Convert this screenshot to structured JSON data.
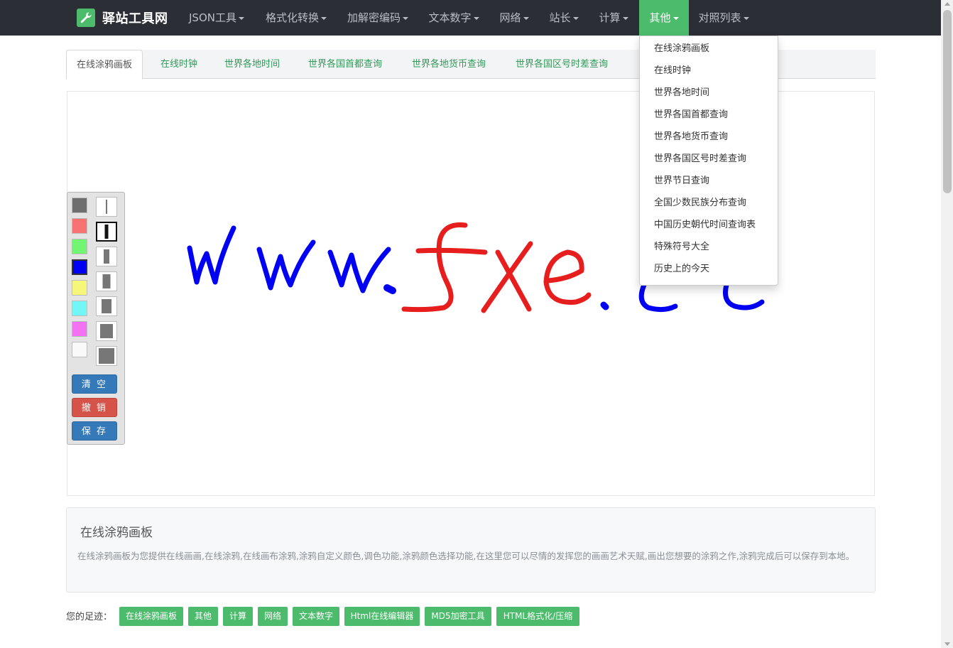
{
  "navbar": {
    "brand": "驿站工具网",
    "items": [
      {
        "label": "JSON工具"
      },
      {
        "label": "格式化转换"
      },
      {
        "label": "加解密编码"
      },
      {
        "label": "文本数字"
      },
      {
        "label": "网络"
      },
      {
        "label": "站长"
      },
      {
        "label": "计算"
      },
      {
        "label": "其他"
      },
      {
        "label": "对照列表"
      }
    ],
    "active_index": 7,
    "active_color": "#4cbb6c",
    "background": "#2b2f35"
  },
  "tabs": [
    {
      "label": "在线涂鸦画板"
    },
    {
      "label": "在线时钟"
    },
    {
      "label": "世界各地时间"
    },
    {
      "label": "世界各国首都查询"
    },
    {
      "label": "世界各地货币查询"
    },
    {
      "label": "世界各国区号时差查询"
    }
  ],
  "dropdown": {
    "items": [
      {
        "label": "在线涂鸦画板"
      },
      {
        "label": "在线时钟"
      },
      {
        "label": "世界各地时间"
      },
      {
        "label": "世界各国首都查询"
      },
      {
        "label": "世界各地货币查询"
      },
      {
        "label": "世界各国区号时差查询"
      },
      {
        "label": "世界节日查询"
      },
      {
        "label": "全国少数民族分布查询"
      },
      {
        "label": "中国历史朝代时间查询表"
      },
      {
        "label": "特殊符号大全"
      },
      {
        "label": "历史上的今天"
      }
    ]
  },
  "toolbox": {
    "colors": [
      "#6e6e6e",
      "#f87272",
      "#72f572",
      "#0000f2",
      "#f6f67a",
      "#72f6f6",
      "#f272f2",
      "#f9f9f9"
    ],
    "selected_color_index": 3,
    "selected_size_index": 1,
    "buttons": {
      "clear": "清 空",
      "undo": "撤 销",
      "save": "保 存"
    }
  },
  "info": {
    "title": "在线涂鸦画板",
    "text": "在线涂鸦画板为您提供在线画画,在线涂鸦,在线画布涂鸦,涂鸦自定义颜色,调色功能,涂鸦颜色选择功能,在这里您可以尽情的发挥您的画画艺术天赋,画出您想要的涂鸦之作,涂鸦完成后可以保存到本地。"
  },
  "footprints": {
    "label": "您的足迹：",
    "tags": [
      {
        "label": "在线涂鸦画板"
      },
      {
        "label": "其他"
      },
      {
        "label": "计算"
      },
      {
        "label": "网络"
      },
      {
        "label": "文本数字"
      },
      {
        "label": "Html在线编辑器"
      },
      {
        "label": "MD5加密工具"
      },
      {
        "label": "HTML格式化/压缩"
      }
    ]
  }
}
